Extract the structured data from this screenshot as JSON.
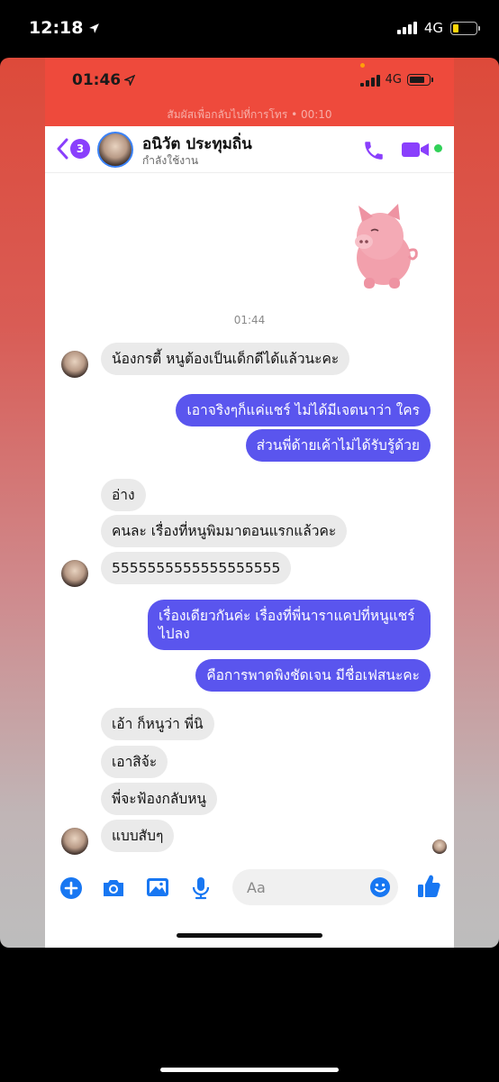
{
  "outer_status": {
    "time": "12:18",
    "network": "4G",
    "colors": {
      "battery": "#ffd60a"
    },
    "battery_level": 0.25,
    "icons": [
      "location-arrow-icon",
      "signal-bars-icon",
      "battery-icon"
    ]
  },
  "inner_status": {
    "time": "01:46",
    "network": "4G",
    "battery_level": 0.8,
    "icons": [
      "location-arrow-icon",
      "signal-bars-icon",
      "battery-icon"
    ]
  },
  "call_banner": "สัมผัสเพื่อกลับไปที่การโทร • 00:10",
  "header": {
    "back_count": "3",
    "contact_name": "อนิวัต ประทุมถิ่น",
    "contact_status": "กำลังใช้งาน",
    "colors": {
      "accent": "#8a3ffc",
      "online": "#31d158"
    },
    "icons": [
      "back-chevron-icon",
      "phone-icon",
      "video-camera-icon"
    ]
  },
  "thread": {
    "sticker": "pig-sticker",
    "timestamp": "01:44",
    "messages": [
      {
        "side": "in",
        "text": "น้องกรตี้  หนูต้องเป็นเด็กดีได้แล้วนะคะ"
      },
      {
        "side": "out",
        "text": "เอาจริงๆก็แค่แชร์ ไม่ได้มีเจตนาว่า ใคร"
      },
      {
        "side": "out",
        "text": "ส่วนพี่ด้ายเค้าไม่ได้รับรู้ด้วย"
      },
      {
        "side": "in",
        "text": "อ่าง"
      },
      {
        "side": "in",
        "text": "คนละ เรื่องที่หนูพิมมาตอนแรกแล้วคะ"
      },
      {
        "side": "in",
        "text": "5555555555555555555"
      },
      {
        "side": "out",
        "text": "เรื่องเดียวกันค่ะ เรื่องที่พี่นาราแคปที่หนูแชร์ไปลง"
      },
      {
        "side": "out",
        "text": "คือการพาดพิงชัดเจน มีชื่อเฟสนะคะ"
      },
      {
        "side": "in",
        "text": "เอ้า ก็หนูว่า พี่นิ"
      },
      {
        "side": "in",
        "text": "เอาสิจ้ะ"
      },
      {
        "side": "in",
        "text": "พี่จะฟ้องกลับหนู"
      },
      {
        "side": "in",
        "text": "แบบสับๆ"
      }
    ],
    "colors": {
      "incoming": "#eaeaea",
      "outgoing": "#5a55ee"
    }
  },
  "composer": {
    "placeholder": "Aa",
    "icons": [
      "plus-icon",
      "camera-icon",
      "gallery-icon",
      "microphone-icon",
      "emoji-icon",
      "like-thumb-icon"
    ],
    "colors": {
      "accent": "#1877f2"
    }
  }
}
